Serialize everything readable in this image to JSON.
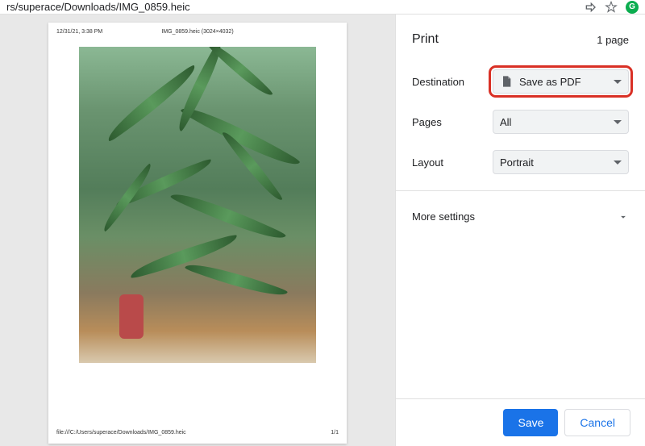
{
  "address_bar": {
    "path": "rs/superace/Downloads/IMG_0859.heic",
    "extension_letter": "G"
  },
  "preview": {
    "timestamp": "12/31/21, 3:38 PM",
    "filename_dims": "IMG_0859.heic (3024×4032)",
    "file_url": "file:///C:/Users/superace/Downloads/IMG_0859.heic",
    "page_num": "1/1"
  },
  "print": {
    "title": "Print",
    "page_count": "1 page",
    "settings": {
      "destination": {
        "label": "Destination",
        "value": "Save as PDF"
      },
      "pages": {
        "label": "Pages",
        "value": "All"
      },
      "layout": {
        "label": "Layout",
        "value": "Portrait"
      }
    },
    "more_settings": "More settings",
    "actions": {
      "save": "Save",
      "cancel": "Cancel"
    }
  }
}
